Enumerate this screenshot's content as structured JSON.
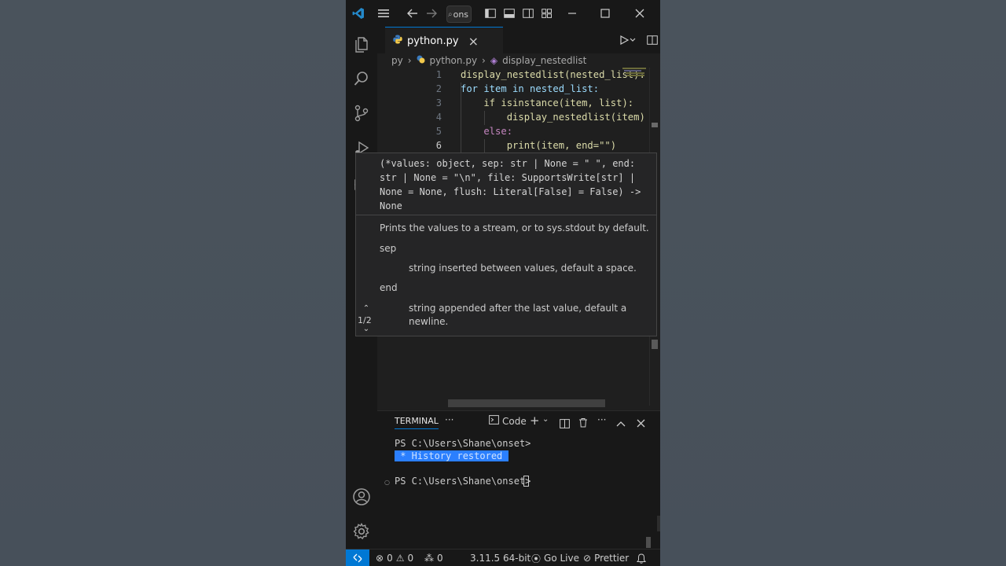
{
  "titlebar": {
    "search_text": "ons"
  },
  "tab": {
    "label": "python.py",
    "close": "×"
  },
  "breadcrumb": {
    "folder": "py",
    "file": "python.py",
    "symbol": "display_nestedlist"
  },
  "editor": {
    "line_numbers": [
      "1",
      "2",
      "3",
      "4",
      "5",
      "6"
    ],
    "lines": [
      "display_nestedlist(nested_list):",
      "for item in nested_list:",
      "    if isinstance(item, list):",
      "        display_nestedlist(item)",
      "    else:",
      "        print(item, end=\"\")"
    ]
  },
  "hover": {
    "signature": "(*values: object, sep: str | None = \" \", end: str | None = \"\\n\", file: SupportsWrite[str] | None = None, flush: Literal[False] = False) -> None",
    "description": "Prints the values to a stream, or to sys.stdout by default.",
    "param1_name": "sep",
    "param1_desc": "string inserted between values, default a space.",
    "param2_name": "end",
    "param2_desc_1": "string appended after the last value, default a",
    "param2_desc_2": "newline.",
    "pager": "1/2"
  },
  "panel": {
    "tab_label": "TERMINAL",
    "more": "···",
    "profile_label": "Code",
    "prompt_1": "PS C:\\Users\\Shane\\onset>",
    "history_restored": " * History restored ",
    "prompt_2": "PS C:\\Users\\Shane\\onset>"
  },
  "status": {
    "errors": "0",
    "warnings": "0",
    "ports": "0",
    "python_version": "3.11.5 64-bit",
    "golive": "Go Live",
    "prettier": "Prettier"
  },
  "colors": {
    "accent": "#0078d4",
    "status_remote": "#0078d4",
    "keyword": "#c586c0",
    "function": "#dcdcaa",
    "variable": "#9cdcfe"
  }
}
